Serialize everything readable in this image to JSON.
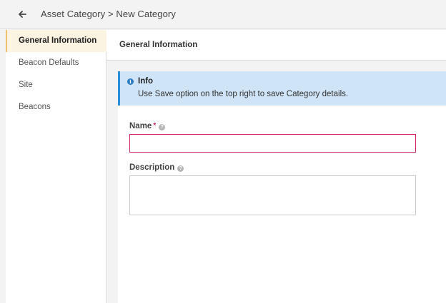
{
  "header": {
    "back_icon": "arrow-left-icon",
    "breadcrumb": "Asset Category > New Category"
  },
  "sidebar": {
    "items": [
      {
        "label": "General Information",
        "active": true
      },
      {
        "label": "Beacon Defaults",
        "active": false
      },
      {
        "label": "Site",
        "active": false
      },
      {
        "label": "Beacons",
        "active": false
      }
    ]
  },
  "panel": {
    "title": "General Information"
  },
  "info": {
    "icon": "info-icon",
    "title": "Info",
    "text": "Use Save option on the top right to save Category details."
  },
  "form": {
    "name": {
      "label": "Name",
      "required_mark": "*",
      "value": "",
      "help_icon": "question-icon"
    },
    "description": {
      "label": "Description",
      "value": "",
      "help_icon": "question-icon"
    }
  },
  "colors": {
    "accent": "#f0c26d",
    "info_border": "#2b8fd8",
    "info_bg": "#cfe4f7",
    "required": "#d0236b"
  }
}
